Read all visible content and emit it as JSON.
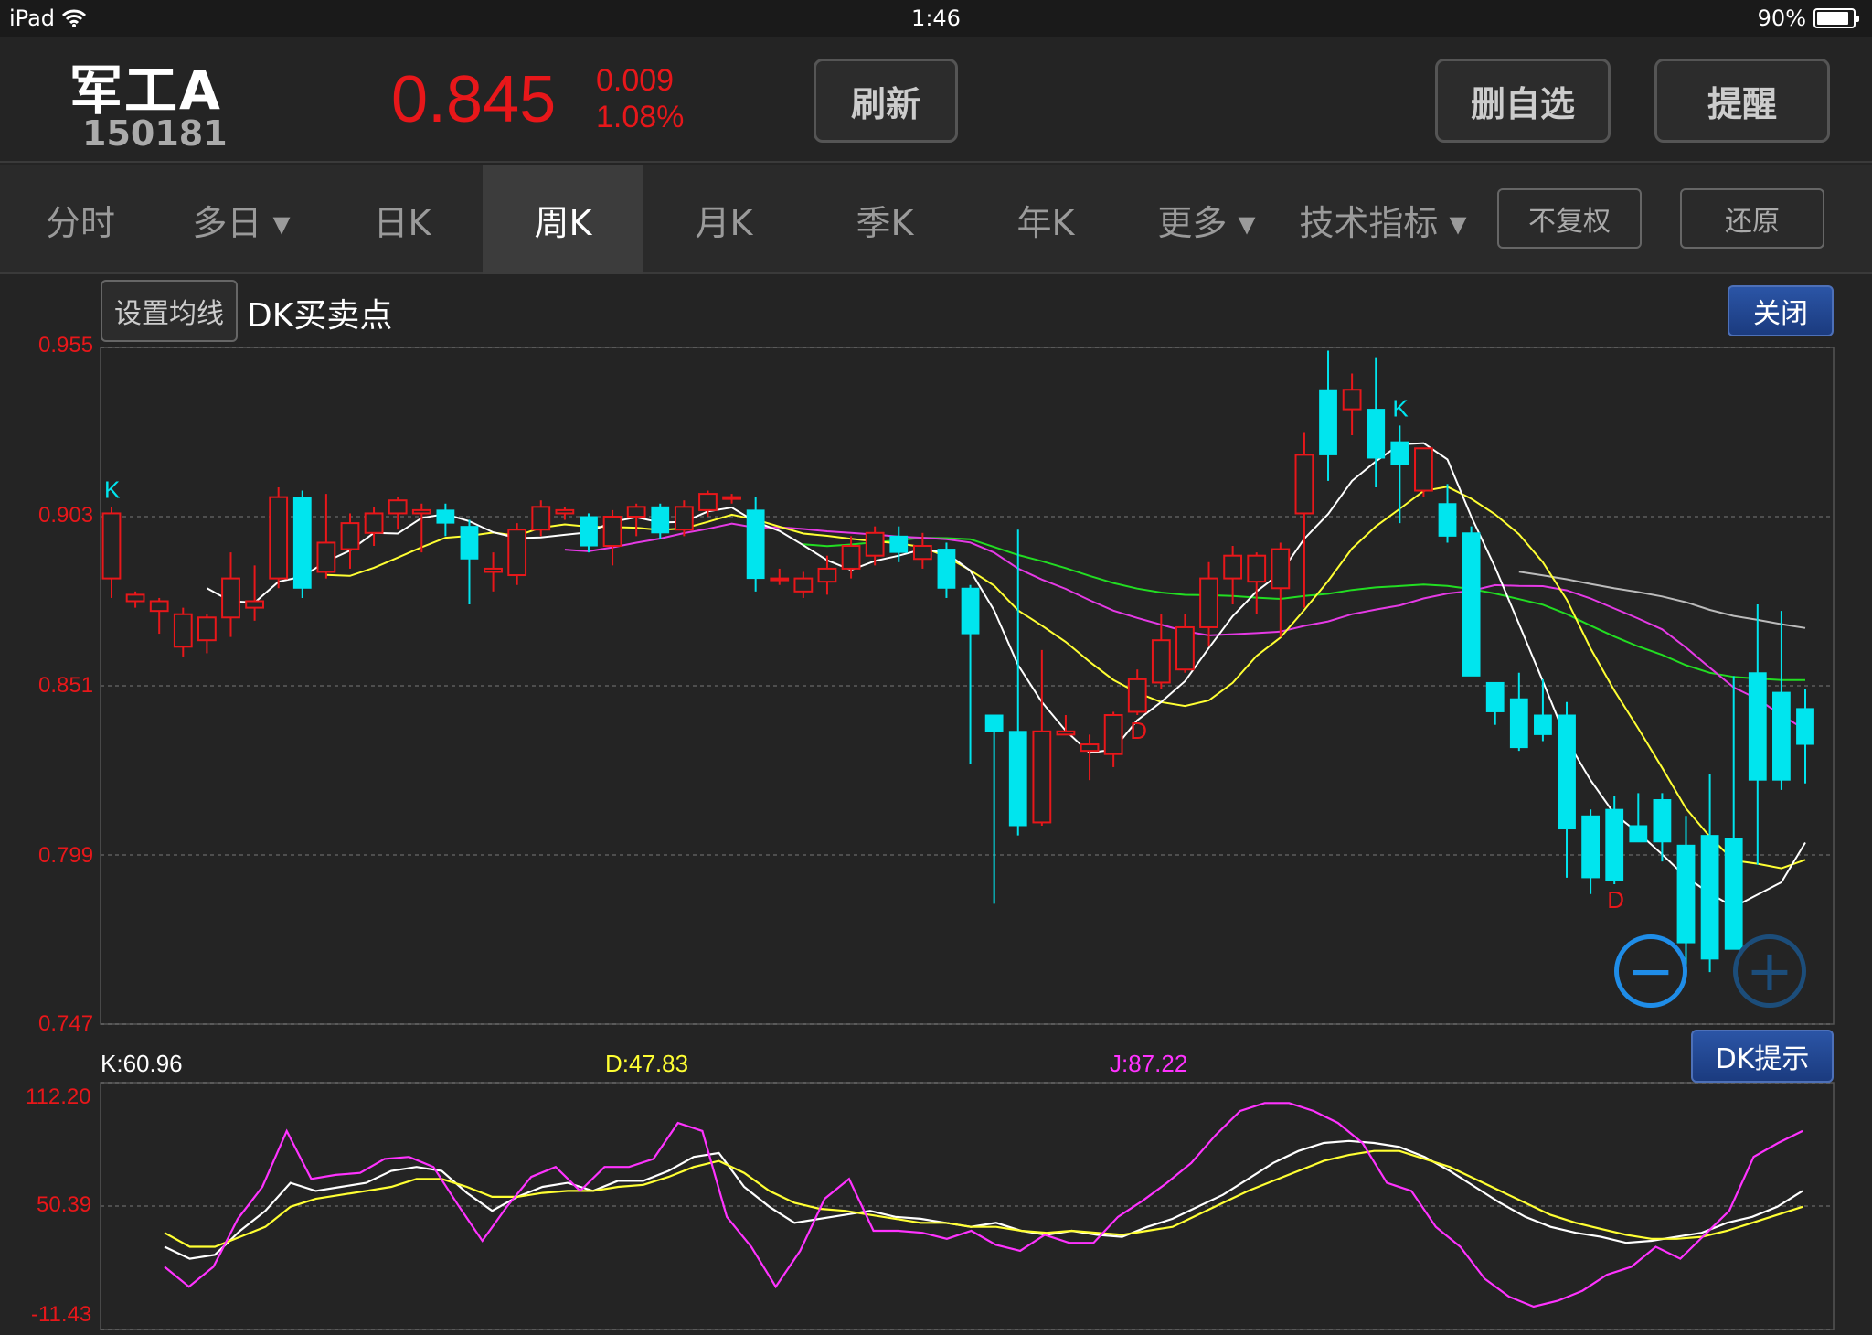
{
  "status_bar": {
    "device": "iPad",
    "time": "1:46",
    "battery": "90%",
    "battery_level": 0.9
  },
  "header": {
    "name": "军工A",
    "code": "150181",
    "price": "0.845",
    "change": "0.009",
    "change_pct": "1.08%",
    "refresh_label": "刷新",
    "remove_watch_label": "删自选",
    "alert_label": "提醒"
  },
  "tabs": [
    {
      "label": "分时"
    },
    {
      "label": "多日 ▾"
    },
    {
      "label": "日K"
    },
    {
      "label": "周K",
      "active": true
    },
    {
      "label": "月K"
    },
    {
      "label": "季K"
    },
    {
      "label": "年K"
    },
    {
      "label": "更多 ▾"
    },
    {
      "label": "技术指标 ▾"
    }
  ],
  "adjust_buttons": {
    "no_adjust": "不复权",
    "restore": "还原"
  },
  "chart_controls": {
    "set_ma_label": "设置均线",
    "indicator_title": "DK买卖点",
    "close_label": "关闭",
    "dk_hint_label": "DK提示",
    "zoom_out": "−",
    "zoom_in": "+"
  },
  "kdj": {
    "k": "K:60.96",
    "d": "D:47.83",
    "j": "J:87.22"
  },
  "colors": {
    "up": "#e8171a",
    "down": "#00e5ee",
    "ma5": "#ffffff",
    "ma10": "#ffff33",
    "ma20": "#e53ae5",
    "ma30": "#22dd22",
    "ma60": "#bbbbbb",
    "k_line": "#ffffff",
    "d_line": "#ffff33",
    "j_line": "#ff33ff"
  },
  "chart_data": [
    {
      "type": "candlestick",
      "title": "DK买卖点",
      "y_ticks": [
        "0.955",
        "0.903",
        "0.851",
        "0.799",
        "0.747"
      ],
      "ylim": [
        0.747,
        0.955
      ],
      "markers": [
        {
          "index": 0,
          "label": "K"
        },
        {
          "index": 43,
          "label": "D"
        },
        {
          "index": 54,
          "label": "K"
        },
        {
          "index": 63,
          "label": "D"
        }
      ],
      "candles": [
        [
          0.884,
          0.904,
          0.878,
          0.906
        ],
        [
          0.877,
          0.879,
          0.875,
          0.88
        ],
        [
          0.874,
          0.877,
          0.867,
          0.878
        ],
        [
          0.863,
          0.873,
          0.86,
          0.875
        ],
        [
          0.865,
          0.872,
          0.861,
          0.873
        ],
        [
          0.872,
          0.884,
          0.866,
          0.892
        ],
        [
          0.875,
          0.877,
          0.871,
          0.888
        ],
        [
          0.884,
          0.909,
          0.881,
          0.912
        ],
        [
          0.909,
          0.881,
          0.878,
          0.911
        ],
        [
          0.886,
          0.895,
          0.884,
          0.91
        ],
        [
          0.893,
          0.901,
          0.887,
          0.904
        ],
        [
          0.898,
          0.904,
          0.894,
          0.906
        ],
        [
          0.904,
          0.908,
          0.899,
          0.909
        ],
        [
          0.904,
          0.905,
          0.892,
          0.907
        ],
        [
          0.905,
          0.901,
          0.897,
          0.907
        ],
        [
          0.9,
          0.89,
          0.876,
          0.902
        ],
        [
          0.886,
          0.887,
          0.88,
          0.892
        ],
        [
          0.885,
          0.899,
          0.882,
          0.901
        ],
        [
          0.899,
          0.906,
          0.897,
          0.908
        ],
        [
          0.904,
          0.905,
          0.902,
          0.906
        ],
        [
          0.903,
          0.894,
          0.892,
          0.904
        ],
        [
          0.894,
          0.903,
          0.888,
          0.905
        ],
        [
          0.903,
          0.906,
          0.897,
          0.907
        ],
        [
          0.906,
          0.898,
          0.896,
          0.907
        ],
        [
          0.899,
          0.906,
          0.897,
          0.908
        ],
        [
          0.905,
          0.91,
          0.903,
          0.911
        ],
        [
          0.909,
          0.909,
          0.907,
          0.91
        ],
        [
          0.905,
          0.884,
          0.88,
          0.909
        ],
        [
          0.884,
          0.884,
          0.882,
          0.887
        ],
        [
          0.88,
          0.884,
          0.878,
          0.886
        ],
        [
          0.883,
          0.887,
          0.879,
          0.891
        ],
        [
          0.887,
          0.894,
          0.884,
          0.897
        ],
        [
          0.891,
          0.898,
          0.888,
          0.9
        ],
        [
          0.897,
          0.892,
          0.889,
          0.9
        ],
        [
          0.89,
          0.894,
          0.887,
          0.898
        ],
        [
          0.893,
          0.881,
          0.878,
          0.895
        ],
        [
          0.881,
          0.867,
          0.827,
          0.882
        ],
        [
          0.842,
          0.837,
          0.784,
          0.84
        ],
        [
          0.837,
          0.808,
          0.805,
          0.899
        ],
        [
          0.809,
          0.837,
          0.808,
          0.862
        ],
        [
          0.836,
          0.837,
          0.836,
          0.842
        ],
        [
          0.831,
          0.833,
          0.822,
          0.836
        ],
        [
          0.83,
          0.842,
          0.826,
          0.843
        ],
        [
          0.843,
          0.853,
          0.842,
          0.856
        ],
        [
          0.852,
          0.865,
          0.85,
          0.873
        ],
        [
          0.856,
          0.869,
          0.855,
          0.873
        ],
        [
          0.869,
          0.884,
          0.863,
          0.889
        ],
        [
          0.884,
          0.891,
          0.876,
          0.894
        ],
        [
          0.883,
          0.891,
          0.873,
          0.892
        ],
        [
          0.881,
          0.893,
          0.866,
          0.895
        ],
        [
          0.904,
          0.922,
          0.875,
          0.929
        ],
        [
          0.942,
          0.922,
          0.914,
          0.954
        ],
        [
          0.936,
          0.942,
          0.928,
          0.947
        ],
        [
          0.936,
          0.921,
          0.912,
          0.952
        ],
        [
          0.926,
          0.919,
          0.901,
          0.931
        ],
        [
          0.911,
          0.924,
          0.909,
          0.921
        ],
        [
          0.907,
          0.897,
          0.895,
          0.913
        ],
        [
          0.898,
          0.854,
          0.86,
          0.9
        ],
        [
          0.852,
          0.843,
          0.839,
          0.852
        ],
        [
          0.847,
          0.832,
          0.831,
          0.855
        ],
        [
          0.842,
          0.836,
          0.834,
          0.853
        ],
        [
          0.842,
          0.807,
          0.792,
          0.846
        ],
        [
          0.811,
          0.792,
          0.787,
          0.813
        ],
        [
          0.813,
          0.791,
          0.79,
          0.817
        ],
        [
          0.808,
          0.803,
          0.803,
          0.818
        ],
        [
          0.816,
          0.803,
          0.797,
          0.818
        ],
        [
          0.802,
          0.772,
          0.765,
          0.811
        ],
        [
          0.805,
          0.767,
          0.763,
          0.824
        ],
        [
          0.804,
          0.77,
          0.802,
          0.854
        ],
        [
          0.855,
          0.822,
          0.796,
          0.876
        ],
        [
          0.849,
          0.822,
          0.819,
          0.874
        ],
        [
          0.844,
          0.833,
          0.821,
          0.85
        ]
      ]
    },
    {
      "type": "line",
      "title": "KDJ",
      "y_ticks": [
        "112.20",
        "50.39",
        "-11.43"
      ],
      "ylim": [
        -11.43,
        112.2
      ],
      "series": [
        {
          "name": "K",
          "values": [
            30,
            24,
            26,
            38,
            48,
            62,
            58,
            60,
            62,
            68,
            70,
            68,
            57,
            48,
            55,
            60,
            62,
            58,
            63,
            63,
            68,
            75,
            77,
            60,
            50,
            42,
            44,
            46,
            48,
            45,
            44,
            42,
            40,
            42,
            38,
            36,
            38,
            36,
            35,
            40,
            44,
            50,
            56,
            64,
            72,
            78,
            82,
            83,
            82,
            80,
            75,
            68,
            60,
            52,
            45,
            40,
            37,
            35,
            32,
            33,
            35,
            37,
            42,
            45,
            50,
            58
          ]
        },
        {
          "name": "D",
          "values": [
            37,
            30,
            30,
            35,
            40,
            50,
            54,
            56,
            58,
            60,
            64,
            64,
            60,
            55,
            55,
            57,
            58,
            58,
            60,
            61,
            65,
            70,
            73,
            67,
            58,
            52,
            49,
            48,
            46,
            44,
            42,
            42,
            40,
            40,
            38,
            37,
            38,
            37,
            36,
            38,
            40,
            46,
            52,
            58,
            63,
            68,
            73,
            76,
            78,
            78,
            74,
            70,
            64,
            58,
            52,
            46,
            42,
            39,
            36,
            34,
            34,
            35,
            38,
            42,
            46,
            50
          ]
        },
        {
          "name": "J",
          "values": [
            20,
            10,
            20,
            44,
            60,
            88,
            64,
            66,
            67,
            74,
            75,
            70,
            51,
            33,
            50,
            65,
            70,
            58,
            70,
            70,
            74,
            92,
            88,
            45,
            30,
            10,
            28,
            54,
            64,
            38,
            38,
            37,
            34,
            38,
            31,
            28,
            36,
            32,
            32,
            45,
            53,
            62,
            72,
            86,
            98,
            102,
            102,
            98,
            92,
            82,
            62,
            58,
            40,
            30,
            14,
            5,
            0,
            3,
            8,
            16,
            20,
            30,
            24,
            36,
            48,
            75,
            82,
            88
          ]
        }
      ]
    }
  ]
}
